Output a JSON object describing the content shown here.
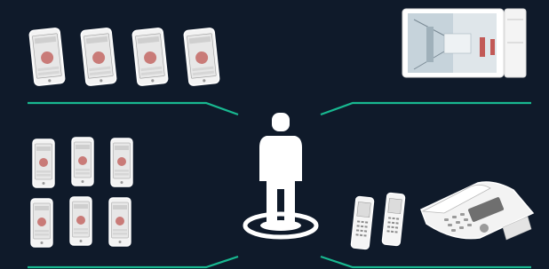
{
  "colors": {
    "background": "#0f1a2a",
    "connector": "#18b890",
    "device_outline": "#ffffff",
    "device_body": "#f3f3f3",
    "screen_content": "#c97b78",
    "person": "#ffffff"
  },
  "nodes": {
    "center": {
      "icon": "person-on-platform-icon"
    },
    "top_left": {
      "icon": "tablet-icon",
      "count": 4
    },
    "top_right": {
      "icon": "video-intercom-monitor-icon",
      "count": 1
    },
    "bottom_left": {
      "icon": "smartphone-icon",
      "count": 6
    },
    "bottom_right": {
      "icons": [
        "cordless-handset-icon",
        "cordless-handset-icon",
        "desk-phone-icon"
      ]
    }
  },
  "connectors": [
    "connector-top-left",
    "connector-top-right",
    "connector-bottom-left",
    "connector-bottom-right"
  ]
}
